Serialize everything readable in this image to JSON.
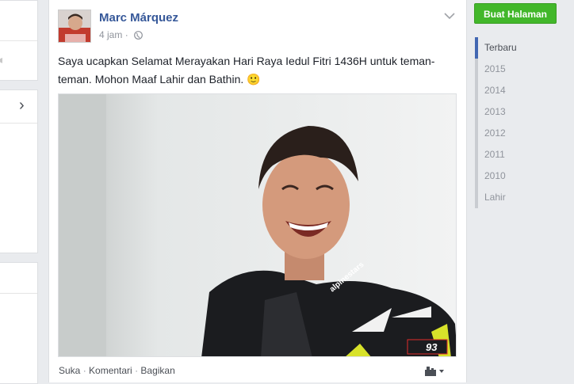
{
  "post": {
    "author": "Marc Márquez",
    "time": "4 jam",
    "separator": "·",
    "text": "Saya ucapkan Selamat Merayakan Hari Raya Iedul Fitri 1436H untuk teman-teman. Mohon Maaf Lahir dan Bathin. 🙂",
    "actions": [
      "Suka",
      "Komentari",
      "Bagikan"
    ],
    "action_separator": " · ",
    "photo": {
      "number_badge": "93",
      "brand_text": "alpinestars"
    }
  },
  "right": {
    "create_page_label": "Buat Halaman",
    "timeline": [
      "Terbaru",
      "2015",
      "2014",
      "2013",
      "2012",
      "2011",
      "2010",
      "Lahir"
    ],
    "timeline_active": "Terbaru"
  },
  "colors": {
    "link": "#365899",
    "accent_green": "#42b72a",
    "timeline_active": "#4267b2",
    "meta_gray": "#90949c"
  }
}
